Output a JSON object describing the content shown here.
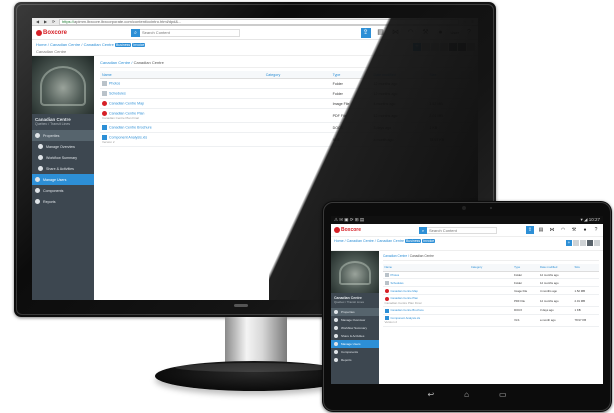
{
  "browser": {
    "url_secure": "https://",
    "url_rest": "apimm.lbxcore.lbxcorporate.com/content/ccintro.html/dpd&...",
    "back_icon": "arrow-left-icon",
    "forward_icon": "arrow-right-icon",
    "reload_icon": "reload-icon"
  },
  "header": {
    "logo_text": "Boxcore",
    "search_placeholder": "Search Content",
    "search_icon": "search-icon",
    "icons": [
      "upload-icon",
      "clipboard-icon",
      "share-icon",
      "speedometer-icon",
      "wrench-icon",
      "user-icon",
      "help-icon"
    ],
    "user_label": "User",
    "accent_color": "#2d8fd6",
    "brand_color": "#d62027"
  },
  "breadcrumb": {
    "items": [
      "Home",
      "Canadian Centre",
      "Canadian Centre"
    ],
    "badges": [
      "Business",
      "Invoice"
    ],
    "subline": "Canadian Centre"
  },
  "sidebar": {
    "title": "Canadian Centre",
    "subtitle": "Quebec / Transit Lines",
    "items": [
      {
        "label": "Properties",
        "icon": "folder-icon",
        "state": "active"
      },
      {
        "label": "Manage Overview",
        "icon": "overview-icon",
        "state": "nested"
      },
      {
        "label": "Workflow Summary",
        "icon": "workflow-icon",
        "state": "nested"
      },
      {
        "label": "Share & Activities",
        "icon": "share-icon",
        "state": "nested"
      },
      {
        "label": "Manage Users",
        "icon": "users-icon",
        "state": "sel"
      },
      {
        "label": "Components",
        "icon": "components-icon",
        "state": ""
      },
      {
        "label": "Reports",
        "icon": "reports-icon",
        "state": ""
      }
    ]
  },
  "main": {
    "path": [
      "Canadian Centre",
      "Canadian Centre"
    ],
    "columns": [
      "Name",
      "Category",
      "Type",
      "Date modified",
      "Size"
    ],
    "rows": [
      {
        "icon": "folder",
        "name": "Photos",
        "sub": "",
        "category": "",
        "type": "Folder",
        "date": "12 months ago",
        "size": ""
      },
      {
        "icon": "folder",
        "name": "Schedules",
        "sub": "",
        "category": "",
        "type": "Folder",
        "date": "12 months ago",
        "size": ""
      },
      {
        "icon": "pdf",
        "name": "Canadian Centre Map",
        "sub": "",
        "category": "",
        "type": "Image File",
        "date": "4 months ago",
        "size": "1.52 MB"
      },
      {
        "icon": "pdf",
        "name": "Canadian Centre Plan",
        "sub": "Canadian Centre Plan Final",
        "category": "",
        "type": "PDF File",
        "date": "12 months ago",
        "size": "2.01 MB"
      },
      {
        "icon": "doc",
        "name": "Canadian Centre Brochure",
        "sub": "",
        "category": "",
        "type": "DOCX",
        "date": "3 days ago",
        "size": "1 KB"
      },
      {
        "icon": "doc",
        "name": "Component Analysis.xls",
        "sub": "Version 2",
        "category": "",
        "type": "XLS",
        "date": "a month ago",
        "size": "78.97 KB"
      }
    ]
  },
  "tablet": {
    "status_left": "⚠ ✉ ▣ ⟳ ⊞ ▤",
    "status_right": "▾ ◢ 10:27",
    "nav_icons": [
      "back-icon",
      "home-icon",
      "recents-icon"
    ]
  }
}
